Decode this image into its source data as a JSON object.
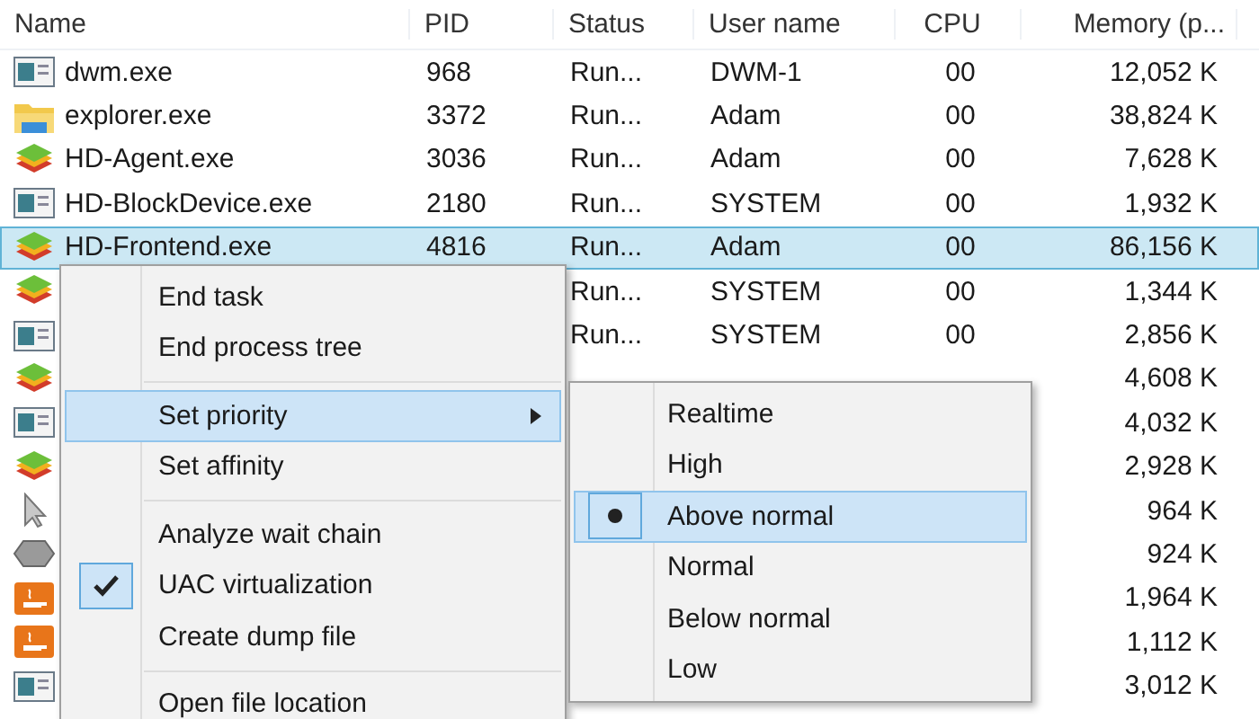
{
  "columns": [
    "Name",
    "PID",
    "Status",
    "User name",
    "CPU",
    "Memory (p..."
  ],
  "rows": [
    {
      "kind": "window",
      "name": "dwm.exe",
      "pid": "968",
      "status": "Run...",
      "user": "DWM-1",
      "cpu": "00",
      "memory": "12,052 K",
      "selected": false
    },
    {
      "kind": "folder",
      "name": "explorer.exe",
      "pid": "3372",
      "status": "Run...",
      "user": "Adam",
      "cpu": "00",
      "memory": "38,824 K",
      "selected": false
    },
    {
      "kind": "stack",
      "name": "HD-Agent.exe",
      "pid": "3036",
      "status": "Run...",
      "user": "Adam",
      "cpu": "00",
      "memory": "7,628 K",
      "selected": false
    },
    {
      "kind": "window",
      "name": "HD-BlockDevice.exe",
      "pid": "2180",
      "status": "Run...",
      "user": "SYSTEM",
      "cpu": "00",
      "memory": "1,932 K",
      "selected": false
    },
    {
      "kind": "stack",
      "name": "HD-Frontend.exe",
      "pid": "4816",
      "status": "Run...",
      "user": "Adam",
      "cpu": "00",
      "memory": "86,156 K",
      "selected": true
    },
    {
      "kind": "stack",
      "status": "Run...",
      "user": "SYSTEM",
      "cpu": "00",
      "memory": "1,344 K",
      "selected": false
    },
    {
      "kind": "window",
      "status": "Run...",
      "user": "SYSTEM",
      "cpu": "00",
      "memory": "2,856 K",
      "selected": false
    },
    {
      "kind": "stack",
      "memory": "4,608 K",
      "selected": false
    },
    {
      "kind": "window",
      "memory": "4,032 K",
      "selected": false
    },
    {
      "kind": "stack",
      "memory": "2,928 K",
      "selected": false
    },
    {
      "kind": "cursor",
      "memory": "964 K",
      "selected": false
    },
    {
      "kind": "disk",
      "memory": "924 K",
      "selected": false
    },
    {
      "kind": "cup",
      "memory": "1,964 K",
      "selected": false
    },
    {
      "kind": "cup",
      "memory": "1,112 K",
      "selected": false
    },
    {
      "kind": "window",
      "memory": "3,012 K",
      "selected": false
    }
  ],
  "context_menu": [
    {
      "kind": "item",
      "label": "End task",
      "checked": false,
      "selected": false
    },
    {
      "kind": "item",
      "label": "End process tree",
      "checked": false,
      "selected": false
    },
    {
      "kind": "separator"
    },
    {
      "kind": "submenu",
      "label": "Set priority",
      "checked": false,
      "selected": true
    },
    {
      "kind": "item",
      "label": "Set affinity",
      "checked": false,
      "selected": false
    },
    {
      "kind": "separator"
    },
    {
      "kind": "item",
      "label": "Analyze wait chain",
      "checked": false,
      "selected": false
    },
    {
      "kind": "item",
      "label": "UAC virtualization",
      "checked": true,
      "selected": false
    },
    {
      "kind": "item",
      "label": "Create dump file",
      "checked": false,
      "selected": false
    },
    {
      "kind": "separator"
    },
    {
      "kind": "item",
      "label": "Open file location",
      "checked": false,
      "selected": false
    }
  ],
  "priority_submenu": [
    {
      "label": "Realtime",
      "checked": false,
      "selected": false
    },
    {
      "label": "High",
      "checked": false,
      "selected": false
    },
    {
      "label": "Above normal",
      "checked": true,
      "selected": true
    },
    {
      "label": "Normal",
      "checked": false,
      "selected": false
    },
    {
      "label": "Below normal",
      "checked": false,
      "selected": false
    },
    {
      "label": "Low",
      "checked": false,
      "selected": false
    }
  ]
}
